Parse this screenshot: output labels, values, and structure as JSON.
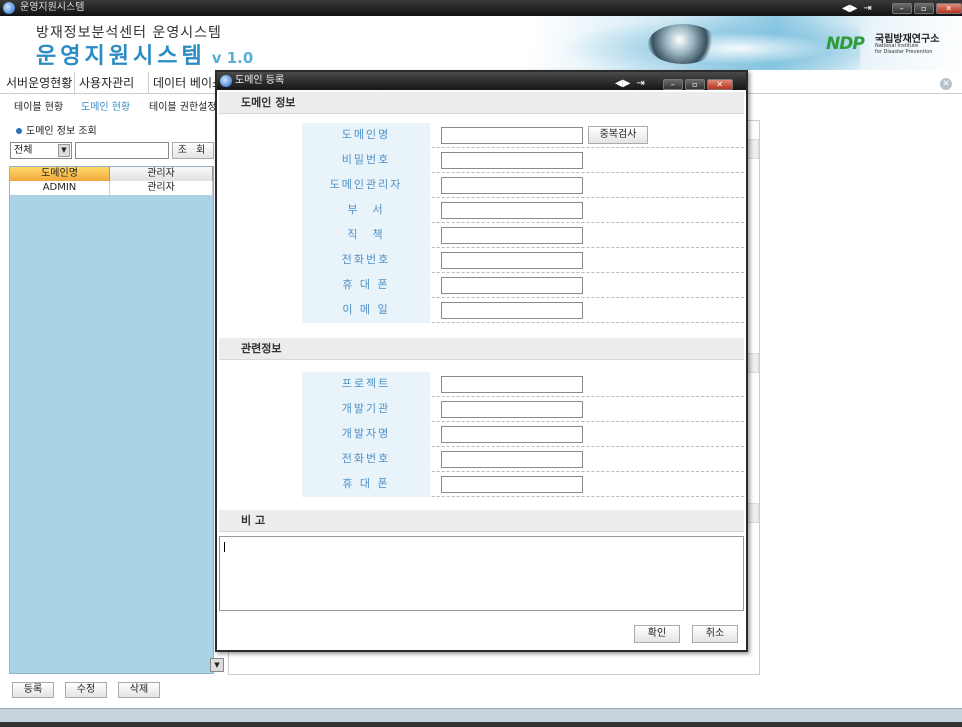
{
  "window": {
    "title": "운영지원시스템",
    "controls": [
      "◀▶",
      "⇥",
      "–",
      "▫",
      "✕"
    ]
  },
  "header": {
    "subtitle": "방재정보분석센터 운영시스템",
    "title": "운영지원시스템",
    "version": "v 1.0",
    "logo": {
      "mark": "NDP",
      "name_kr": "국립방재연구소",
      "name_en_line1": "National Institute",
      "name_en_line2": "for Disaster Prevention"
    }
  },
  "menu": {
    "items": [
      {
        "label": "서버운영현황"
      },
      {
        "label": "사용자관리"
      },
      {
        "label": "데이터 베이스"
      }
    ],
    "sub_items": [
      {
        "label": "테이블 현황"
      },
      {
        "label": "도메인 현황",
        "active": true
      },
      {
        "label": "테이블 권한설정"
      }
    ]
  },
  "left_panel": {
    "section_title": "도메인 정보 조회",
    "filter_value": "전체",
    "search_button": "조 회",
    "grid": {
      "columns": [
        "도메인명",
        "관리자"
      ],
      "rows": [
        [
          "ADMIN",
          "관리자"
        ]
      ]
    },
    "buttons": {
      "add": "등록",
      "edit": "수정",
      "delete": "삭제"
    }
  },
  "modal": {
    "title": "도메인 등록",
    "section1": {
      "title": "도메인 정보",
      "fields": [
        {
          "label": "도메인명",
          "value": ""
        },
        {
          "label": "비밀번호",
          "value": ""
        },
        {
          "label": "도메인관리자",
          "value": ""
        },
        {
          "label": "부　서",
          "value": ""
        },
        {
          "label": "직　책",
          "value": ""
        },
        {
          "label": "전화번호",
          "value": ""
        },
        {
          "label": "휴 대 폰",
          "value": ""
        },
        {
          "label": "이 메 일",
          "value": ""
        }
      ],
      "dup_check_button": "중복검사"
    },
    "section2": {
      "title": "관련정보",
      "fields": [
        {
          "label": "프로젝트",
          "value": ""
        },
        {
          "label": "개발기관",
          "value": ""
        },
        {
          "label": "개발자명",
          "value": ""
        },
        {
          "label": "전화번호",
          "value": ""
        },
        {
          "label": "휴 대 폰",
          "value": ""
        }
      ]
    },
    "section3": {
      "title": "비 고"
    },
    "buttons": {
      "confirm": "확인",
      "cancel": "취소"
    }
  },
  "colors": {
    "brand_blue": "#2a8cc4",
    "label_blue": "#4f92c8",
    "grid_bg": "#aad4e4",
    "grid_header_selected": "#f3a93b",
    "ndp_green": "#2e9c3a"
  }
}
